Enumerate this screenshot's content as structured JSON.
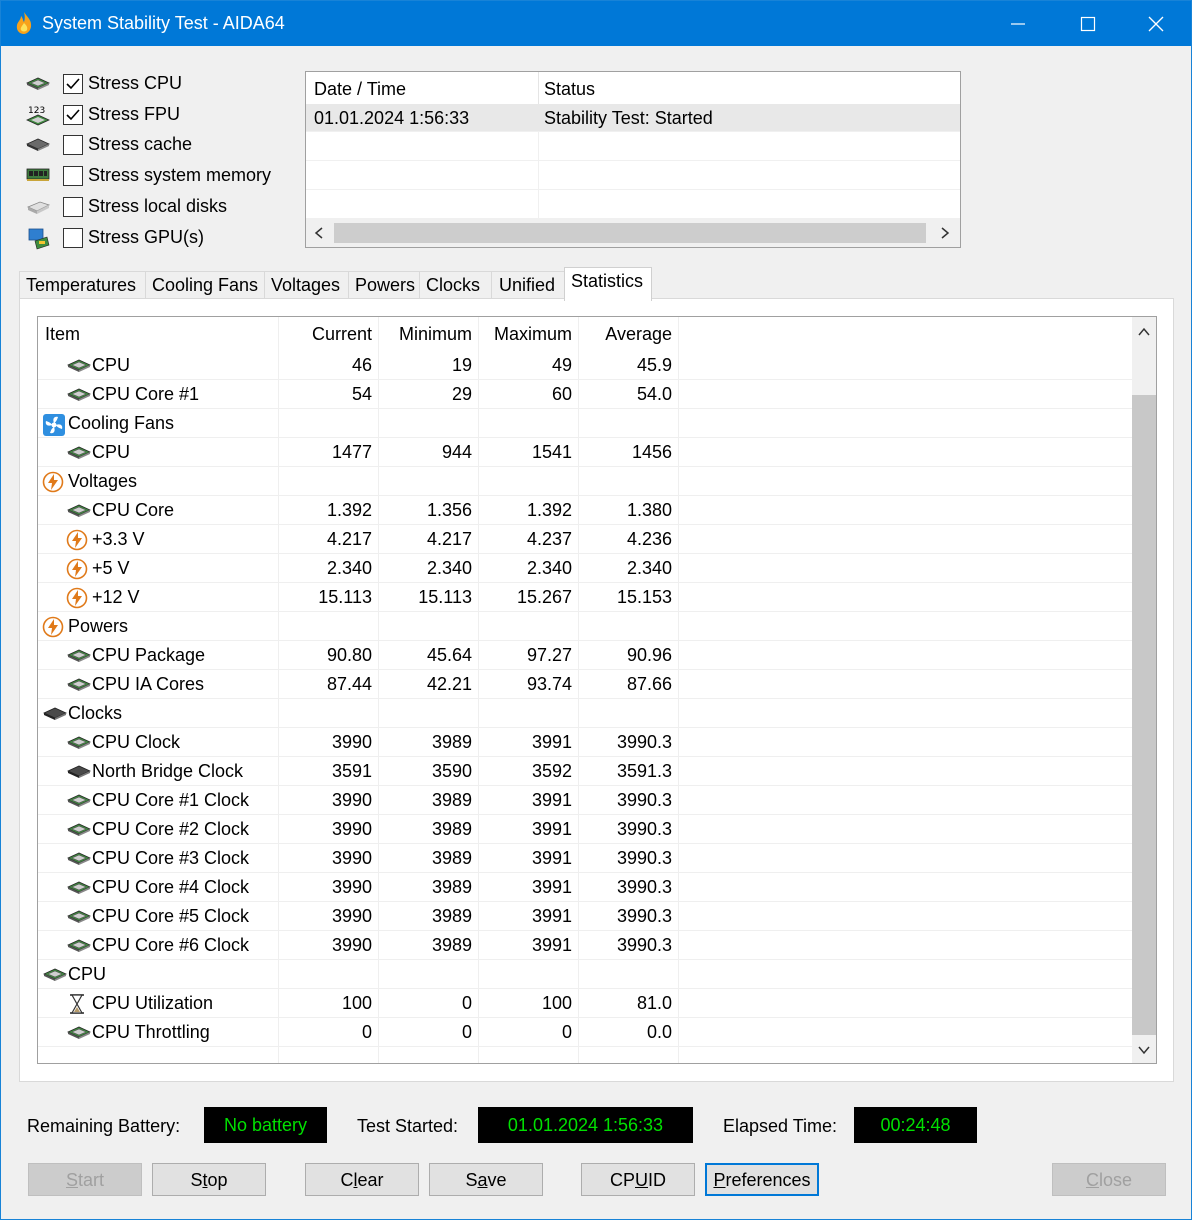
{
  "window": {
    "title": "System Stability Test - AIDA64"
  },
  "stress_options": [
    {
      "label": "Stress CPU",
      "checked": true,
      "icon": "cpu-chip-icon"
    },
    {
      "label": "Stress FPU",
      "checked": true,
      "icon": "fpu-123-icon"
    },
    {
      "label": "Stress cache",
      "checked": false,
      "icon": "cache-chip-icon"
    },
    {
      "label": "Stress system memory",
      "checked": false,
      "icon": "memory-module-icon"
    },
    {
      "label": "Stress local disks",
      "checked": false,
      "icon": "disk-drive-icon"
    },
    {
      "label": "Stress GPU(s)",
      "checked": false,
      "icon": "gpu-monitor-icon"
    }
  ],
  "log": {
    "headers": [
      "Date / Time",
      "Status"
    ],
    "rows": [
      {
        "datetime": "01.01.2024 1:56:33",
        "status": "Stability Test: Started"
      }
    ]
  },
  "tabs": [
    "Temperatures",
    "Cooling Fans",
    "Voltages",
    "Powers",
    "Clocks",
    "Unified",
    "Statistics"
  ],
  "active_tab": "Statistics",
  "stats": {
    "headers": [
      "Item",
      "Current",
      "Minimum",
      "Maximum",
      "Average"
    ],
    "rows": [
      {
        "item": "CPU",
        "icon": "cpu-chip-icon",
        "level": 1,
        "cur": "46",
        "min": "19",
        "max": "49",
        "avg": "45.9"
      },
      {
        "item": "CPU Core #1",
        "icon": "cpu-chip-icon",
        "level": 1,
        "cur": "54",
        "min": "29",
        "max": "60",
        "avg": "54.0"
      },
      {
        "item": "Cooling Fans",
        "icon": "fan-icon",
        "level": 0,
        "cur": "",
        "min": "",
        "max": "",
        "avg": ""
      },
      {
        "item": "CPU",
        "icon": "cpu-chip-icon",
        "level": 1,
        "cur": "1477",
        "min": "944",
        "max": "1541",
        "avg": "1456"
      },
      {
        "item": "Voltages",
        "icon": "lightning-icon",
        "level": 0,
        "cur": "",
        "min": "",
        "max": "",
        "avg": ""
      },
      {
        "item": "CPU Core",
        "icon": "cpu-chip-icon",
        "level": 1,
        "cur": "1.392",
        "min": "1.356",
        "max": "1.392",
        "avg": "1.380"
      },
      {
        "item": "+3.3 V",
        "icon": "lightning-icon",
        "level": 1,
        "cur": "4.217",
        "min": "4.217",
        "max": "4.237",
        "avg": "4.236"
      },
      {
        "item": "+5 V",
        "icon": "lightning-icon",
        "level": 1,
        "cur": "2.340",
        "min": "2.340",
        "max": "2.340",
        "avg": "2.340"
      },
      {
        "item": "+12 V",
        "icon": "lightning-icon",
        "level": 1,
        "cur": "15.113",
        "min": "15.113",
        "max": "15.267",
        "avg": "15.153"
      },
      {
        "item": "Powers",
        "icon": "lightning-icon",
        "level": 0,
        "cur": "",
        "min": "",
        "max": "",
        "avg": ""
      },
      {
        "item": "CPU Package",
        "icon": "cpu-chip-icon",
        "level": 1,
        "cur": "90.80",
        "min": "45.64",
        "max": "97.27",
        "avg": "90.96"
      },
      {
        "item": "CPU IA Cores",
        "icon": "cpu-chip-icon",
        "level": 1,
        "cur": "87.44",
        "min": "42.21",
        "max": "93.74",
        "avg": "87.66"
      },
      {
        "item": "Clocks",
        "icon": "chipset-icon",
        "level": 0,
        "cur": "",
        "min": "",
        "max": "",
        "avg": ""
      },
      {
        "item": "CPU Clock",
        "icon": "cpu-chip-icon",
        "level": 1,
        "cur": "3990",
        "min": "3989",
        "max": "3991",
        "avg": "3990.3"
      },
      {
        "item": "North Bridge Clock",
        "icon": "chipset-icon",
        "level": 1,
        "cur": "3591",
        "min": "3590",
        "max": "3592",
        "avg": "3591.3"
      },
      {
        "item": "CPU Core #1 Clock",
        "icon": "cpu-chip-icon",
        "level": 1,
        "cur": "3990",
        "min": "3989",
        "max": "3991",
        "avg": "3990.3"
      },
      {
        "item": "CPU Core #2 Clock",
        "icon": "cpu-chip-icon",
        "level": 1,
        "cur": "3990",
        "min": "3989",
        "max": "3991",
        "avg": "3990.3"
      },
      {
        "item": "CPU Core #3 Clock",
        "icon": "cpu-chip-icon",
        "level": 1,
        "cur": "3990",
        "min": "3989",
        "max": "3991",
        "avg": "3990.3"
      },
      {
        "item": "CPU Core #4 Clock",
        "icon": "cpu-chip-icon",
        "level": 1,
        "cur": "3990",
        "min": "3989",
        "max": "3991",
        "avg": "3990.3"
      },
      {
        "item": "CPU Core #5 Clock",
        "icon": "cpu-chip-icon",
        "level": 1,
        "cur": "3990",
        "min": "3989",
        "max": "3991",
        "avg": "3990.3"
      },
      {
        "item": "CPU Core #6 Clock",
        "icon": "cpu-chip-icon",
        "level": 1,
        "cur": "3990",
        "min": "3989",
        "max": "3991",
        "avg": "3990.3"
      },
      {
        "item": "CPU",
        "icon": "cpu-chip-icon",
        "level": 0,
        "cur": "",
        "min": "",
        "max": "",
        "avg": ""
      },
      {
        "item": "CPU Utilization",
        "icon": "hourglass-icon",
        "level": 1,
        "cur": "100",
        "min": "0",
        "max": "100",
        "avg": "81.0"
      },
      {
        "item": "CPU Throttling",
        "icon": "cpu-chip-icon",
        "level": 1,
        "cur": "0",
        "min": "0",
        "max": "0",
        "avg": "0.0"
      }
    ]
  },
  "status": {
    "battery_label": "Remaining Battery:",
    "battery_value": "No battery",
    "started_label": "Test Started:",
    "started_value": "01.01.2024 1:56:33",
    "elapsed_label": "Elapsed Time:",
    "elapsed_value": "00:24:48"
  },
  "buttons": {
    "start": {
      "pre": "",
      "key": "S",
      "post": "tart"
    },
    "stop": {
      "pre": "S",
      "key": "t",
      "post": "op"
    },
    "clear": {
      "pre": "C",
      "key": "l",
      "post": "ear"
    },
    "save": {
      "pre": "S",
      "key": "a",
      "post": "ve"
    },
    "cpuid": {
      "pre": "CP",
      "key": "U",
      "post": "ID"
    },
    "preferences": {
      "pre": "",
      "key": "P",
      "post": "references"
    },
    "close": {
      "pre": "",
      "key": "C",
      "post": "lose"
    }
  },
  "colors": {
    "titlebar": "#0078d7",
    "status_text": "#00e000",
    "status_bg": "#000000"
  }
}
